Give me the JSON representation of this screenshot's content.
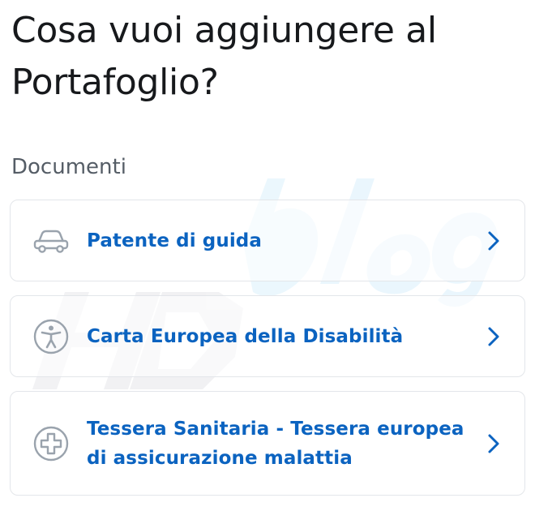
{
  "header": {
    "title": "Cosa vuoi aggiungere al Portafoglio?"
  },
  "section": {
    "label": "Documenti"
  },
  "items": [
    {
      "label": "Patente di guida",
      "icon": "car-icon"
    },
    {
      "label": "Carta Europea della Disabilità",
      "icon": "accessibility-icon"
    },
    {
      "label": "Tessera Sanitaria - Tessera europea di assicurazione malattia",
      "icon": "health-cross-icon"
    }
  ],
  "colors": {
    "accent": "#0b63c0",
    "title": "#17191c",
    "section": "#555d66",
    "icon": "#9aa3ad",
    "card_border": "#e3e6ea"
  }
}
